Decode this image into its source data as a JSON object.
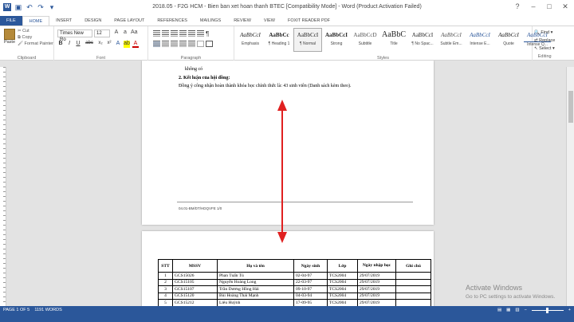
{
  "window": {
    "title": "2018.05 - F2G HCM - Bien ban xet hoan thanh BTEC [Compatibility Mode] - Word (Product Activation Failed)",
    "controls": [
      "?",
      "–",
      "□",
      "✕"
    ]
  },
  "tabs": [
    "FILE",
    "HOME",
    "INSERT",
    "DESIGN",
    "PAGE LAYOUT",
    "REFERENCES",
    "MAILINGS",
    "REVIEW",
    "VIEW",
    "FOXIT READER PDF"
  ],
  "ribbon": {
    "clipboard": {
      "paste": "Paste",
      "cut": "Cut",
      "copy": "Copy",
      "format_painter": "Format Painter",
      "label": "Clipboard"
    },
    "font": {
      "name": "Times New Ro",
      "size": "12",
      "label": "Font",
      "buttons": [
        "B",
        "I",
        "U",
        "abc",
        "x₂",
        "x²"
      ]
    },
    "paragraph": {
      "label": "Paragraph"
    },
    "styles": {
      "label": "Styles",
      "items": [
        {
          "preview": "AaBbCcI",
          "name": "Emphasis"
        },
        {
          "preview": "AaBbCc",
          "name": "¶ Heading 1"
        },
        {
          "preview": "AaBbCcI",
          "name": "¶ Normal"
        },
        {
          "preview": "AaBbCcI",
          "name": "Strong"
        },
        {
          "preview": "AaBbCcD",
          "name": "Subtitle"
        },
        {
          "preview": "AaBbC",
          "name": "Title"
        },
        {
          "preview": "AaBbCcI",
          "name": "¶ No Spac..."
        },
        {
          "preview": "AaBbCcI",
          "name": "Subtle Em..."
        },
        {
          "preview": "AaBbCcI",
          "name": "Intense E..."
        },
        {
          "preview": "AaBbCcI",
          "name": "Quote"
        },
        {
          "preview": "AaBbCcI",
          "name": "Intense Q..."
        }
      ]
    },
    "editing": {
      "find": "Find",
      "replace": "Replace",
      "select": "Select",
      "label": "Editing"
    }
  },
  "ruler": {
    "marks": [
      "1",
      "2",
      "1",
      "2",
      "3",
      "4",
      "5",
      "6",
      "7",
      "8",
      "9",
      "10",
      "11",
      "12",
      "13",
      "14",
      "15",
      "16",
      "17",
      "18"
    ]
  },
  "page1": {
    "line_top": "không có",
    "heading": "2. Kết luận của hội đồng:",
    "body": "Đồng ý công nhận hoàn thành khóa học chính thức là:  43 sinh viên (Danh sách kèm theo).",
    "footer_code": "04.01-BM/DT/HDQVFE 1/0"
  },
  "table": {
    "headers": [
      "STT",
      "MSSV",
      "Họ và tên",
      "Ngày sinh",
      "Lớp",
      "Ngày nhập học",
      "Ghi chú"
    ],
    "rows": [
      [
        "1",
        "GCS15026",
        "Phan Tuấn Tú",
        "02-04-97",
        "TCS2004",
        "29/07/2019",
        ""
      ],
      [
        "2",
        "GCS15105",
        "Nguyễn Hoàng Long",
        "22-03-97",
        "TCS2004",
        "29/07/2019",
        ""
      ],
      [
        "3",
        "GCS15107",
        "Trần Dương Hồng Hải",
        "09-10-97",
        "TCS2004",
        "29/07/2019",
        ""
      ],
      [
        "4",
        "GCS15120",
        "Bùi Hoàng Thái Mạnh",
        "04-03-94",
        "TCS2004",
        "29/07/2019",
        ""
      ],
      [
        "5",
        "GCS15212",
        "Liêu Huỳnh",
        "17-09-95",
        "TCS2004",
        "29/07/2019",
        ""
      ]
    ]
  },
  "status": {
    "page": "PAGE 1 OF 5",
    "words": "1191 WORDS"
  },
  "watermark": {
    "title": "Activate Windows",
    "sub": "Go to PC settings to activate Windows."
  },
  "colors": {
    "word_blue": "#2b579a",
    "arrow_red": "#e02020"
  }
}
